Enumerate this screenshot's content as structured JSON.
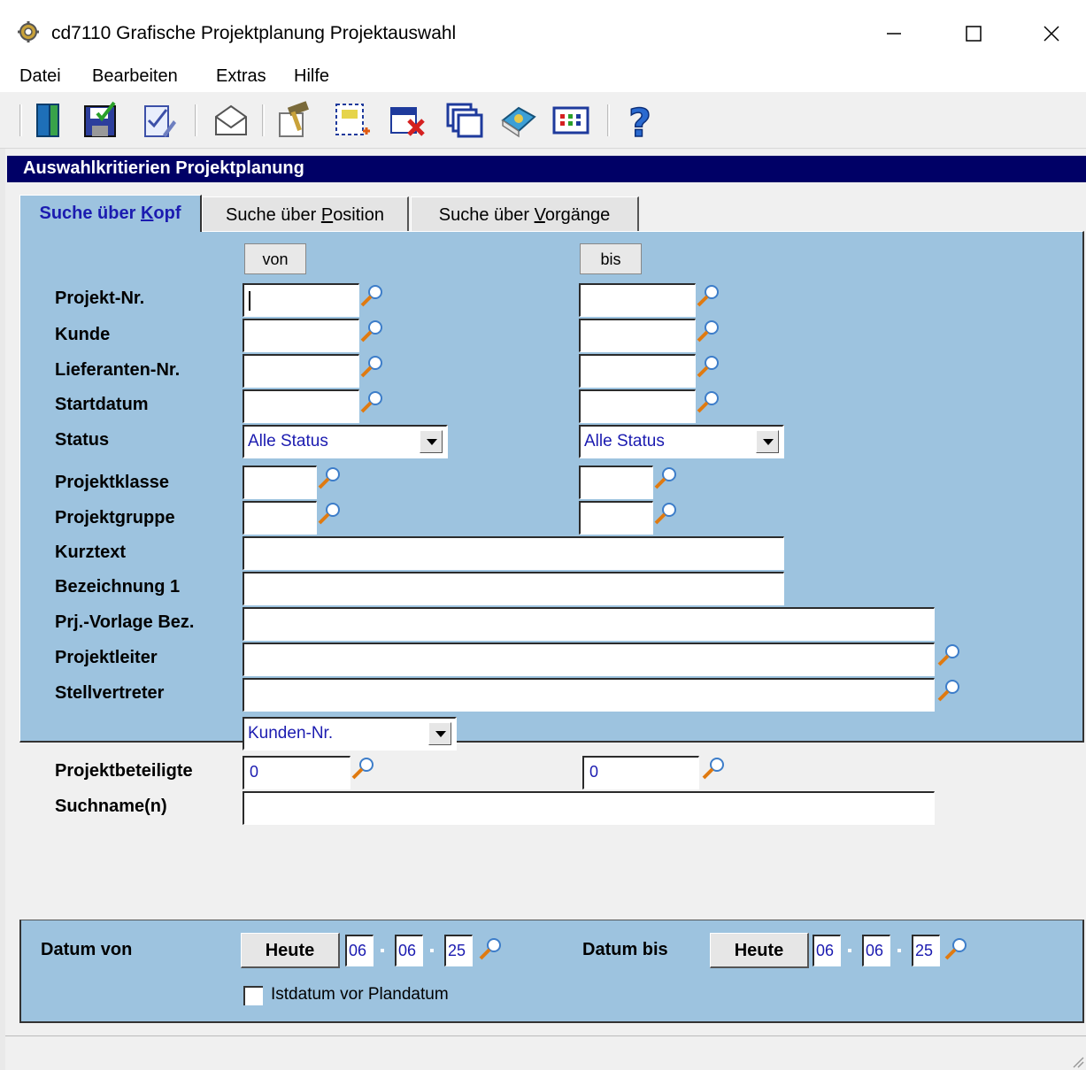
{
  "window": {
    "title": "cd7110 Grafische Projektplanung Projektauswahl"
  },
  "menu": [
    "Datei",
    "Bearbeiten",
    "Extras",
    "Hilfe"
  ],
  "toolbar": {
    "icons": [
      "exit-door-icon",
      "save-disk-icon",
      "edit-check-icon",
      "mail-envelope-icon",
      "hammer-icon",
      "new-selection-icon",
      "delete-selection-icon",
      "windows-icon",
      "book-icon",
      "grid-table-icon",
      "help-question-icon"
    ]
  },
  "section": {
    "title": "Auswahlkritierien Projektplanung"
  },
  "tabs": [
    {
      "pre": "Suche über ",
      "key": "K",
      "post": "opf"
    },
    {
      "pre": "Suche über ",
      "key": "P",
      "post": "osition"
    },
    {
      "pre": "Suche über ",
      "key": "V",
      "post": "orgänge"
    }
  ],
  "columns": {
    "from": "von",
    "to": "bis"
  },
  "labels": {
    "projekt_nr": "Projekt-Nr.",
    "kunde": "Kunde",
    "lieferanten_nr": "Lieferanten-Nr.",
    "startdatum": "Startdatum",
    "status": "Status",
    "projektklasse": "Projektklasse",
    "projektgruppe": "Projektgruppe",
    "kurztext": "Kurztext",
    "bezeichnung1": "Bezeichnung 1",
    "vorlage": "Prj.-Vorlage Bez.",
    "projektleiter": "Projektleiter",
    "stellvertreter": "Stellvertreter",
    "projektbeteiligte": "Projektbeteiligte",
    "suchname": "Suchname(n)"
  },
  "values": {
    "status_from": "Alle Status",
    "status_to": "Alle Status",
    "beteiligte_type": "Kunden-Nr.",
    "beteiligte_from": "0",
    "beteiligte_to": "0"
  },
  "dates": {
    "from_label": "Datum von",
    "to_label": "Datum bis",
    "today_label": "Heute",
    "from_day": "06",
    "from_month": "06",
    "from_year": "25",
    "to_day": "06",
    "to_month": "06",
    "to_year": "25",
    "checkbox_label": "Istdatum vor Plandatum"
  },
  "colors": {
    "panel": "#9dc3df",
    "header": "#000066",
    "value_text": "#1b1bb0"
  }
}
